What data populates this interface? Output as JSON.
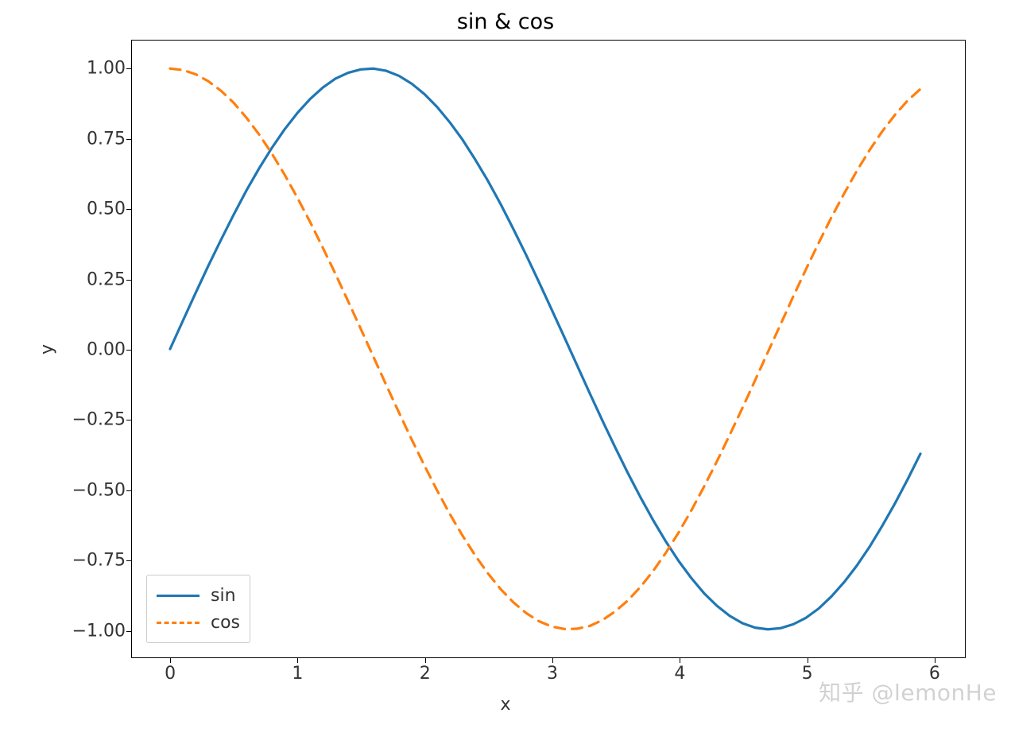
{
  "chart_data": {
    "type": "line",
    "title": "sin & cos",
    "xlabel": "x",
    "ylabel": "y",
    "xlim": [
      -0.3,
      6.25
    ],
    "ylim": [
      -1.1,
      1.1
    ],
    "x_ticks": [
      0,
      1,
      2,
      3,
      4,
      5,
      6
    ],
    "y_ticks": [
      -1.0,
      -0.75,
      -0.5,
      -0.25,
      0.0,
      0.25,
      0.5,
      0.75,
      1.0
    ],
    "y_tick_labels": [
      "−1.00",
      "−0.75",
      "−0.50",
      "−0.25",
      "0.00",
      "0.25",
      "0.50",
      "0.75",
      "1.00"
    ],
    "grid": false,
    "legend_position": "lower-left",
    "series": [
      {
        "name": "sin",
        "color": "#1f77b4",
        "linestyle": "solid",
        "x": [
          0.0,
          0.1,
          0.2,
          0.3,
          0.4,
          0.5,
          0.6,
          0.7,
          0.8,
          0.9,
          1.0,
          1.1,
          1.2,
          1.3,
          1.4,
          1.5,
          1.6,
          1.7,
          1.8,
          1.9,
          2.0,
          2.1,
          2.2,
          2.3,
          2.4,
          2.5,
          2.6,
          2.7,
          2.8,
          2.9,
          3.0,
          3.1,
          3.2,
          3.3,
          3.4,
          3.5,
          3.6,
          3.7,
          3.8,
          3.9,
          4.0,
          4.1,
          4.2,
          4.3,
          4.4,
          4.5,
          4.6,
          4.7,
          4.8,
          4.9,
          5.0,
          5.1,
          5.2,
          5.3,
          5.4,
          5.5,
          5.6,
          5.7,
          5.8,
          5.9
        ],
        "values": [
          0.0,
          0.1,
          0.199,
          0.296,
          0.389,
          0.479,
          0.565,
          0.644,
          0.717,
          0.783,
          0.841,
          0.891,
          0.932,
          0.964,
          0.985,
          0.997,
          1.0,
          0.992,
          0.974,
          0.946,
          0.909,
          0.863,
          0.808,
          0.746,
          0.675,
          0.599,
          0.516,
          0.427,
          0.335,
          0.239,
          0.141,
          0.042,
          -0.058,
          -0.158,
          -0.256,
          -0.351,
          -0.443,
          -0.53,
          -0.612,
          -0.688,
          -0.757,
          -0.818,
          -0.872,
          -0.916,
          -0.952,
          -0.978,
          -0.994,
          -1.0,
          -0.996,
          -0.982,
          -0.959,
          -0.926,
          -0.883,
          -0.832,
          -0.773,
          -0.706,
          -0.631,
          -0.551,
          -0.465,
          -0.374
        ]
      },
      {
        "name": "cos",
        "color": "#ff7f0e",
        "linestyle": "dashed",
        "x": [
          0.0,
          0.1,
          0.2,
          0.3,
          0.4,
          0.5,
          0.6,
          0.7,
          0.8,
          0.9,
          1.0,
          1.1,
          1.2,
          1.3,
          1.4,
          1.5,
          1.6,
          1.7,
          1.8,
          1.9,
          2.0,
          2.1,
          2.2,
          2.3,
          2.4,
          2.5,
          2.6,
          2.7,
          2.8,
          2.9,
          3.0,
          3.1,
          3.2,
          3.3,
          3.4,
          3.5,
          3.6,
          3.7,
          3.8,
          3.9,
          4.0,
          4.1,
          4.2,
          4.3,
          4.4,
          4.5,
          4.6,
          4.7,
          4.8,
          4.9,
          5.0,
          5.1,
          5.2,
          5.3,
          5.4,
          5.5,
          5.6,
          5.7,
          5.8,
          5.9
        ],
        "values": [
          1.0,
          0.995,
          0.98,
          0.955,
          0.921,
          0.878,
          0.825,
          0.765,
          0.697,
          0.622,
          0.54,
          0.454,
          0.362,
          0.268,
          0.17,
          0.071,
          -0.029,
          -0.129,
          -0.227,
          -0.323,
          -0.416,
          -0.505,
          -0.589,
          -0.666,
          -0.737,
          -0.801,
          -0.857,
          -0.904,
          -0.942,
          -0.971,
          -0.99,
          -0.999,
          -0.998,
          -0.988,
          -0.967,
          -0.936,
          -0.897,
          -0.848,
          -0.791,
          -0.726,
          -0.654,
          -0.575,
          -0.49,
          -0.401,
          -0.307,
          -0.211,
          -0.112,
          -0.012,
          0.087,
          0.187,
          0.284,
          0.378,
          0.469,
          0.554,
          0.635,
          0.709,
          0.776,
          0.835,
          0.886,
          0.927
        ]
      }
    ]
  },
  "watermark": "知乎 @lemonHe"
}
